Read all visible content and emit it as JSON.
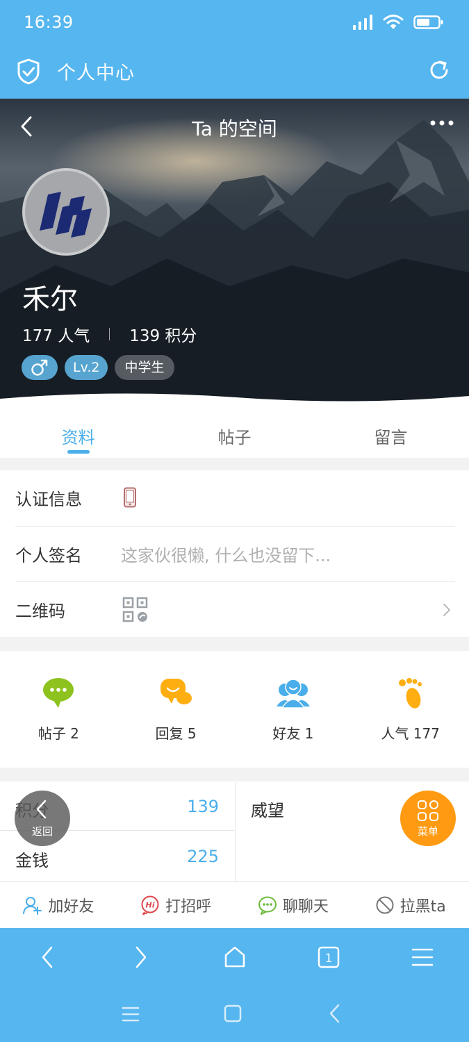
{
  "status_bar": {
    "time": "16:39",
    "icons": [
      "signal-icon",
      "wifi-icon",
      "battery-icon"
    ]
  },
  "app_header": {
    "title": "个人中心",
    "icons": [
      "shield-check-icon",
      "refresh-icon"
    ]
  },
  "profile": {
    "page_title": "Ta 的空间",
    "name": "禾尔",
    "popularity": "177 人气",
    "points": "139 积分",
    "tags": {
      "gender": "♂",
      "level": "Lv.2",
      "grade": "中学生"
    }
  },
  "tabs": [
    {
      "label": "资料",
      "active": true
    },
    {
      "label": "帖子",
      "active": false
    },
    {
      "label": "留言",
      "active": false
    }
  ],
  "info": {
    "cert_label": "认证信息",
    "signature_label": "个人签名",
    "signature_value": "这家伙很懒, 什么也没留下...",
    "qrcode_label": "二维码"
  },
  "quick_stats": [
    {
      "label": "帖子 2",
      "icon": "chat-bubble-icon",
      "color": "#8dc21f"
    },
    {
      "label": "回复 5",
      "icon": "reply-bubble-icon",
      "color": "#ffae12"
    },
    {
      "label": "好友 1",
      "icon": "friends-icon",
      "color": "#4aaeea"
    },
    {
      "label": "人气 177",
      "icon": "footprint-icon",
      "color": "#ffae12"
    }
  ],
  "points_table": {
    "jifen_label": "积分",
    "jifen_value": "139",
    "jinqian_label": "金钱",
    "jinqian_value": "225",
    "weiwang_label": "威望"
  },
  "actions": [
    {
      "label": "加好友",
      "icon": "add-friend-icon"
    },
    {
      "label": "打招呼",
      "icon": "hi-icon"
    },
    {
      "label": "聊聊天",
      "icon": "chat-icon"
    },
    {
      "label": "拉黑ta",
      "icon": "block-icon"
    }
  ],
  "floating": {
    "back_label": "返回",
    "menu_label": "菜单"
  },
  "browser_toolbar": {
    "tab_count": "1"
  },
  "colors": {
    "header": "#56b6ef",
    "accent": "#4aaeea",
    "menu_button": "#ff9a12"
  }
}
